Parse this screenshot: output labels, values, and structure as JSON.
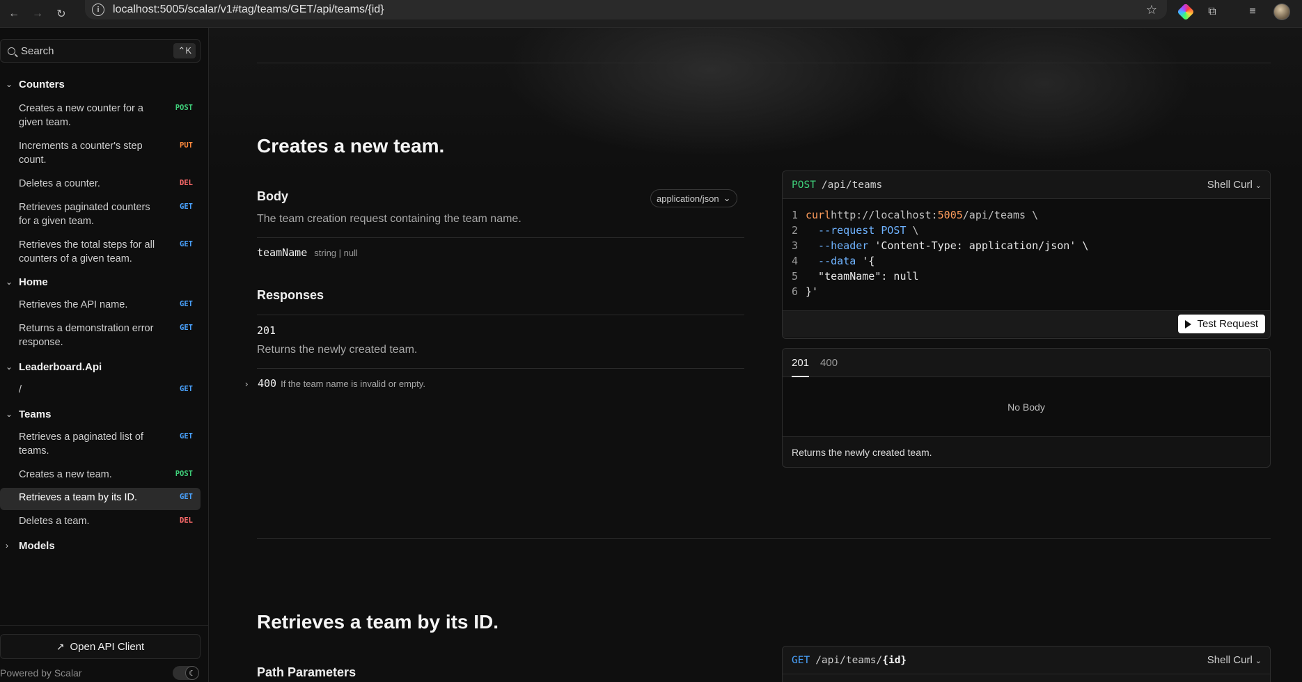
{
  "browser": {
    "url": "localhost:5005/scalar/v1#tag/teams/GET/api/teams/{id}"
  },
  "sidebar": {
    "search_placeholder": "Search",
    "search_shortcut": "⌃K",
    "groups": [
      {
        "label": "Counters"
      },
      {
        "label": "Home"
      },
      {
        "label": "Leaderboard.Api"
      },
      {
        "label": "Teams"
      },
      {
        "label": "Models"
      }
    ],
    "items": [
      {
        "label": "Creates a new counter for a given team.",
        "method": "POST"
      },
      {
        "label": "Increments a counter's step count.",
        "method": "PUT"
      },
      {
        "label": "Deletes a counter.",
        "method": "DEL"
      },
      {
        "label": "Retrieves paginated counters for a given team.",
        "method": "GET"
      },
      {
        "label": "Retrieves the total steps for all counters of a given team.",
        "method": "GET"
      },
      {
        "label": "Retrieves the API name.",
        "method": "GET"
      },
      {
        "label": "Returns a demonstration error response.",
        "method": "GET"
      },
      {
        "label": "/",
        "method": "GET"
      },
      {
        "label": "Retrieves a paginated list of teams.",
        "method": "GET"
      },
      {
        "label": "Creates a new team.",
        "method": "POST"
      },
      {
        "label": "Retrieves a team by its ID.",
        "method": "GET"
      },
      {
        "label": "Deletes a team.",
        "method": "DEL"
      }
    ],
    "open_api_client": "Open API Client",
    "powered_by": "Powered by Scalar"
  },
  "section1": {
    "title": "Creates a new team.",
    "body_title": "Body",
    "content_type": "application/json",
    "body_desc": "The team creation request containing the team name.",
    "param_name": "teamName",
    "param_type": "string | null",
    "responses_title": "Responses",
    "resp_201_code": "201",
    "resp_201_desc": "Returns the newly created team.",
    "resp_400_code": "400",
    "resp_400_desc": "If the team name is invalid or empty.",
    "card_method": "POST",
    "card_path": "/api/teams",
    "card_lang": "Shell Curl",
    "code_lines": [
      {
        "n": "1"
      },
      {
        "n": "2"
      },
      {
        "n": "3"
      },
      {
        "n": "4"
      },
      {
        "n": "5"
      },
      {
        "n": "6"
      }
    ],
    "code_tokens": {
      "l1_cmd": "curl",
      "l1_url_a": " http://localhost:",
      "l1_port": "5005",
      "l1_url_b": "/api/teams \\",
      "l2_flag": "  --request",
      "l2_val": " POST",
      "l2_tail": " \\",
      "l3_flag": "  --header",
      "l3_val": " 'Content-Type: application/json' \\",
      "l4_flag": "  --data",
      "l4_val": " '{",
      "l5": "  \"teamName\": null",
      "l6": "}'"
    },
    "test_request": "Test Request",
    "tabs": [
      "201",
      "400"
    ],
    "no_body": "No Body",
    "resp_card_desc": "Returns the newly created team."
  },
  "section2": {
    "title": "Retrieves a team by its ID.",
    "path_params_title": "Path Parameters",
    "card_method": "GET",
    "card_path": "/api/teams/",
    "card_path_param": "{id}",
    "card_lang": "Shell Curl"
  },
  "colors": {
    "post": "#3fd07a",
    "put": "#ff8a3d",
    "del": "#ff6b6b",
    "get": "#4aa3ff"
  }
}
